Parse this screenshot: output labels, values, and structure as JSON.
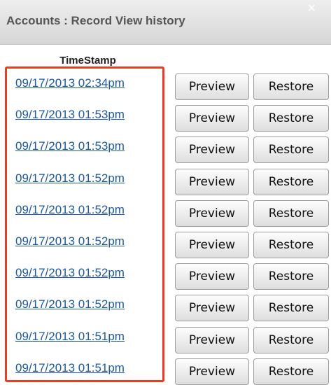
{
  "dialog": {
    "title": "Accounts : Record View history",
    "close_glyph": "×"
  },
  "table": {
    "header_timestamp": "TimeStamp",
    "highlight_color": "#ea3b26",
    "rows": [
      {
        "timestamp": "09/17/2013 02:34pm",
        "preview_label": "Preview",
        "restore_label": "Restore"
      },
      {
        "timestamp": "09/17/2013 01:53pm",
        "preview_label": "Preview",
        "restore_label": "Restore"
      },
      {
        "timestamp": "09/17/2013 01:53pm",
        "preview_label": "Preview",
        "restore_label": "Restore"
      },
      {
        "timestamp": "09/17/2013 01:52pm",
        "preview_label": "Preview",
        "restore_label": "Restore"
      },
      {
        "timestamp": "09/17/2013 01:52pm",
        "preview_label": "Preview",
        "restore_label": "Restore"
      },
      {
        "timestamp": "09/17/2013 01:52pm",
        "preview_label": "Preview",
        "restore_label": "Restore"
      },
      {
        "timestamp": "09/17/2013 01:52pm",
        "preview_label": "Preview",
        "restore_label": "Restore"
      },
      {
        "timestamp": "09/17/2013 01:52pm",
        "preview_label": "Preview",
        "restore_label": "Restore"
      },
      {
        "timestamp": "09/17/2013 01:51pm",
        "preview_label": "Preview",
        "restore_label": "Restore"
      },
      {
        "timestamp": "09/17/2013 01:51pm",
        "preview_label": "Preview",
        "restore_label": "Restore"
      }
    ]
  }
}
